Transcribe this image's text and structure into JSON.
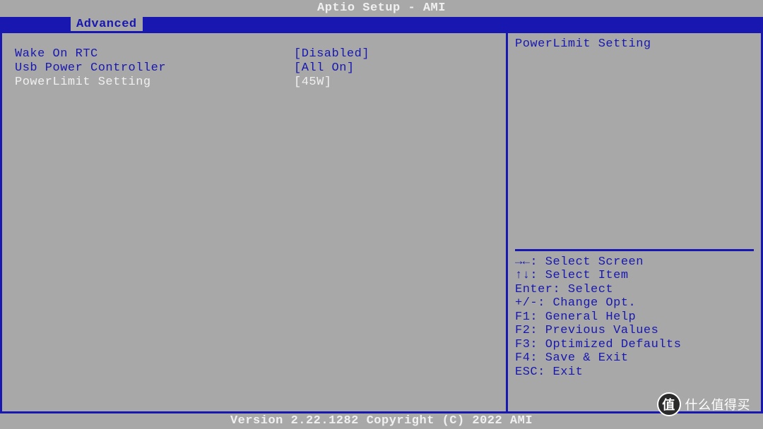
{
  "title": "Aptio Setup - AMI",
  "tabs": {
    "active": "Advanced"
  },
  "options": [
    {
      "label": "Wake On RTC",
      "value": "[Disabled]",
      "selected": false
    },
    {
      "label": "Usb Power Controller",
      "value": "[All On]",
      "selected": false
    },
    {
      "label": "PowerLimit Setting",
      "value": "[45W]",
      "selected": true
    }
  ],
  "help": {
    "description": "PowerLimit Setting",
    "keys": [
      "→←: Select Screen",
      "↑↓: Select Item",
      "Enter: Select",
      "+/-: Change Opt.",
      "F1: General Help",
      "F2: Previous Values",
      "F3: Optimized Defaults",
      "F4: Save & Exit",
      "ESC: Exit"
    ]
  },
  "footer": "Version 2.22.1282 Copyright (C) 2022 AMI",
  "watermark": {
    "badge": "值",
    "text": "什么值得买"
  }
}
